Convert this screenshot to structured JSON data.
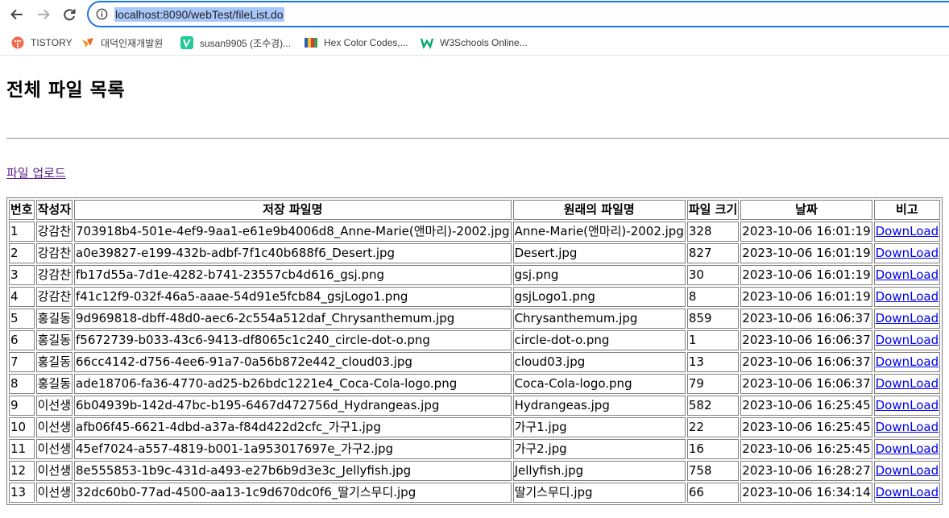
{
  "browser": {
    "url": "localhost:8090/webTest/fileList.do",
    "bookmarks": [
      {
        "label": "TISTORY",
        "icon": "tistory-icon",
        "color": "#f06a4a"
      },
      {
        "label": "대덕인재개발원",
        "icon": "daedeok-icon",
        "color": "#f39a2d"
      },
      {
        "label": "susan9905 (조수경)...",
        "icon": "velog-icon",
        "color": "#20c997"
      },
      {
        "label": "Hex Color Codes,...",
        "icon": "hexcolor-icon",
        "color": "#2f5fb3"
      },
      {
        "label": "W3Schools Online...",
        "icon": "w3schools-icon",
        "color": "#04aa6d"
      }
    ]
  },
  "page": {
    "title": "전체 파일 목록",
    "upload_link": "파일 업로드"
  },
  "table": {
    "headers": [
      "번호",
      "작성자",
      "저장 파일명",
      "원래의 파일명",
      "파일 크기",
      "날짜",
      "비고"
    ],
    "rows": [
      [
        "1",
        "강감찬",
        "703918b4-501e-4ef9-9aa1-e61e9b4006d8_Anne-Marie(앤마리)-2002.jpg",
        "Anne-Marie(앤마리)-2002.jpg",
        "328",
        "2023-10-06 16:01:19",
        "DownLoad"
      ],
      [
        "2",
        "강감찬",
        "a0e39827-e199-432b-adbf-7f1c40b688f6_Desert.jpg",
        "Desert.jpg",
        "827",
        "2023-10-06 16:01:19",
        "DownLoad"
      ],
      [
        "3",
        "강감찬",
        "fb17d55a-7d1e-4282-b741-23557cb4d616_gsj.png",
        "gsj.png",
        "30",
        "2023-10-06 16:01:19",
        "DownLoad"
      ],
      [
        "4",
        "강감찬",
        "f41c12f9-032f-46a5-aaae-54d91e5fcb84_gsjLogo1.png",
        "gsjLogo1.png",
        "8",
        "2023-10-06 16:01:19",
        "DownLoad"
      ],
      [
        "5",
        "홍길동",
        "9d969818-dbff-48d0-aec6-2c554a512daf_Chrysanthemum.jpg",
        "Chrysanthemum.jpg",
        "859",
        "2023-10-06 16:06:37",
        "DownLoad"
      ],
      [
        "6",
        "홍길동",
        "f5672739-b033-43c6-9413-df8065c1c240_circle-dot-o.png",
        "circle-dot-o.png",
        "1",
        "2023-10-06 16:06:37",
        "DownLoad"
      ],
      [
        "7",
        "홍길동",
        "66cc4142-d756-4ee6-91a7-0a56b872e442_cloud03.jpg",
        "cloud03.jpg",
        "13",
        "2023-10-06 16:06:37",
        "DownLoad"
      ],
      [
        "8",
        "홍길동",
        "ade18706-fa36-4770-ad25-b26bdc1221e4_Coca-Cola-logo.png",
        "Coca-Cola-logo.png",
        "79",
        "2023-10-06 16:06:37",
        "DownLoad"
      ],
      [
        "9",
        "이선생",
        "6b04939b-142d-47bc-b195-6467d472756d_Hydrangeas.jpg",
        "Hydrangeas.jpg",
        "582",
        "2023-10-06 16:25:45",
        "DownLoad"
      ],
      [
        "10",
        "이선생",
        "afb06f45-6621-4dbd-a37a-f84d422d2cfc_가구1.jpg",
        "가구1.jpg",
        "22",
        "2023-10-06 16:25:45",
        "DownLoad"
      ],
      [
        "11",
        "이선생",
        "45ef7024-a557-4819-b001-1a953017697e_가구2.jpg",
        "가구2.jpg",
        "16",
        "2023-10-06 16:25:45",
        "DownLoad"
      ],
      [
        "12",
        "이선생",
        "8e555853-1b9c-431d-a493-e27b6b9d3e3c_Jellyfish.jpg",
        "Jellyfish.jpg",
        "758",
        "2023-10-06 16:28:27",
        "DownLoad"
      ],
      [
        "13",
        "이선생",
        "32dc60b0-77ad-4500-aa13-1c9d670dc0f6_딸기스무디.jpg",
        "딸기스무디.jpg",
        "66",
        "2023-10-06 16:34:14",
        "DownLoad"
      ]
    ]
  },
  "colors": {
    "accent": "#1a73e8",
    "url_highlight": "#a8c7fa",
    "link": "#0000ee",
    "visited_link": "#551a8b"
  }
}
